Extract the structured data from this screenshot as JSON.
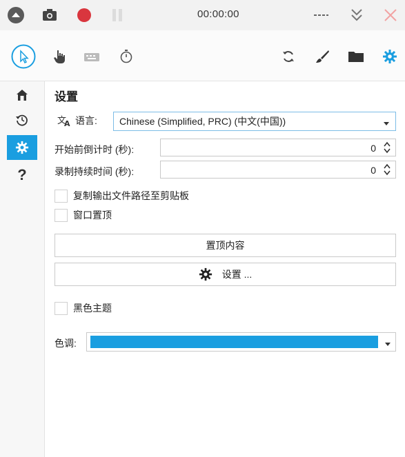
{
  "titlebar": {
    "timer": "00:00:00",
    "icons": [
      "up-arrow-icon",
      "camera-icon",
      "record-icon",
      "pause-icon",
      "more-icon",
      "collapse-icon",
      "close-icon"
    ]
  },
  "toolbar": {
    "tools": [
      "cursor-icon",
      "hand-icon",
      "keyboard-icon",
      "stopwatch-icon",
      "refresh-icon",
      "brush-icon",
      "folder-icon",
      "gear-icon"
    ]
  },
  "sidebar": {
    "items": [
      {
        "icon": "home-icon"
      },
      {
        "icon": "history-icon"
      },
      {
        "icon": "gear-icon",
        "active": true
      },
      {
        "icon": "help-icon",
        "label": "?"
      }
    ]
  },
  "settings": {
    "title": "设置",
    "language_label": "语言:",
    "language_value": "Chinese (Simplified, PRC) (中文(中国))",
    "countdown_label": "开始前倒计时 (秒):",
    "countdown_value": "0",
    "duration_label": "录制持续时间 (秒):",
    "duration_value": "0",
    "copy_path_label": "复制输出文件路径至剪贴板",
    "topmost_label": "窗口置顶",
    "topmost_content_button": "置顶内容",
    "settings_button": "设置 ...",
    "dark_theme_label": "黑色主题",
    "accent_label": "色调:",
    "accent_color": "#1a9ee0"
  }
}
